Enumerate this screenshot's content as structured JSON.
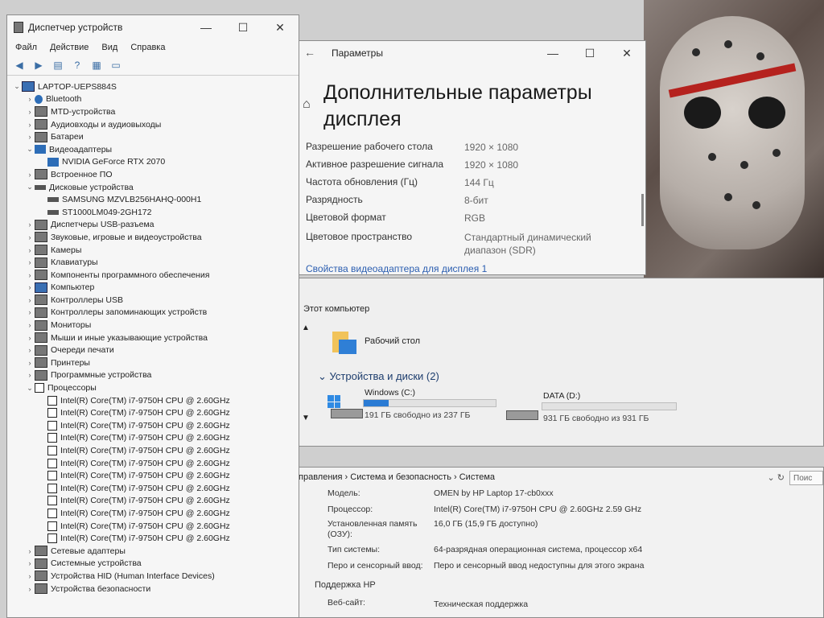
{
  "device_manager": {
    "title": "Диспетчер устройств",
    "menu": [
      "Файл",
      "Действие",
      "Вид",
      "Справка"
    ],
    "controls": {
      "minimize": "—",
      "maximize": "☐",
      "close": "✕"
    },
    "tree": [
      {
        "label": "LAPTOP-UEPS884S",
        "level": 0,
        "expanded": true,
        "icon": "computer-icon"
      },
      {
        "label": "Bluetooth",
        "level": 1,
        "icon": "bluetooth-icon"
      },
      {
        "label": "MTD-устройства",
        "level": 1,
        "icon": "device-icon"
      },
      {
        "label": "Аудиовходы и аудиовыходы",
        "level": 1,
        "icon": "audio-icon"
      },
      {
        "label": "Батареи",
        "level": 1,
        "icon": "battery-icon"
      },
      {
        "label": "Видеоадаптеры",
        "level": 1,
        "expanded": true,
        "icon": "display-adapter-icon"
      },
      {
        "label": "NVIDIA GeForce RTX 2070",
        "level": 2,
        "icon": "display-adapter-icon"
      },
      {
        "label": "Встроенное ПО",
        "level": 1,
        "icon": "firmware-icon"
      },
      {
        "label": "Дисковые устройства",
        "level": 1,
        "expanded": true,
        "icon": "disk-icon"
      },
      {
        "label": "SAMSUNG MZVLB256HAHQ-000H1",
        "level": 2,
        "icon": "disk-icon"
      },
      {
        "label": "ST1000LM049-2GH172",
        "level": 2,
        "icon": "disk-icon"
      },
      {
        "label": "Диспетчеры USB-разъема",
        "level": 1,
        "icon": "usb-icon"
      },
      {
        "label": "Звуковые, игровые и видеоустройства",
        "level": 1,
        "icon": "sound-icon"
      },
      {
        "label": "Камеры",
        "level": 1,
        "icon": "camera-icon"
      },
      {
        "label": "Клавиатуры",
        "level": 1,
        "icon": "keyboard-icon"
      },
      {
        "label": "Компоненты программного обеспечения",
        "level": 1,
        "icon": "software-icon"
      },
      {
        "label": "Компьютер",
        "level": 1,
        "icon": "computer-icon"
      },
      {
        "label": "Контроллеры USB",
        "level": 1,
        "icon": "usb-icon"
      },
      {
        "label": "Контроллеры запоминающих устройств",
        "level": 1,
        "icon": "storage-icon"
      },
      {
        "label": "Мониторы",
        "level": 1,
        "icon": "monitor-icon"
      },
      {
        "label": "Мыши и иные указывающие устройства",
        "level": 1,
        "icon": "mouse-icon"
      },
      {
        "label": "Очереди печати",
        "level": 1,
        "icon": "printer-icon"
      },
      {
        "label": "Принтеры",
        "level": 1,
        "icon": "printer-icon"
      },
      {
        "label": "Программные устройства",
        "level": 1,
        "icon": "software-icon"
      },
      {
        "label": "Процессоры",
        "level": 1,
        "expanded": true,
        "icon": "cpu-icon"
      },
      {
        "label": "Intel(R) Core(TM) i7-9750H CPU @ 2.60GHz",
        "level": 2,
        "icon": "cpu-icon"
      },
      {
        "label": "Intel(R) Core(TM) i7-9750H CPU @ 2.60GHz",
        "level": 2,
        "icon": "cpu-icon"
      },
      {
        "label": "Intel(R) Core(TM) i7-9750H CPU @ 2.60GHz",
        "level": 2,
        "icon": "cpu-icon"
      },
      {
        "label": "Intel(R) Core(TM) i7-9750H CPU @ 2.60GHz",
        "level": 2,
        "icon": "cpu-icon"
      },
      {
        "label": "Intel(R) Core(TM) i7-9750H CPU @ 2.60GHz",
        "level": 2,
        "icon": "cpu-icon"
      },
      {
        "label": "Intel(R) Core(TM) i7-9750H CPU @ 2.60GHz",
        "level": 2,
        "icon": "cpu-icon"
      },
      {
        "label": "Intel(R) Core(TM) i7-9750H CPU @ 2.60GHz",
        "level": 2,
        "icon": "cpu-icon"
      },
      {
        "label": "Intel(R) Core(TM) i7-9750H CPU @ 2.60GHz",
        "level": 2,
        "icon": "cpu-icon"
      },
      {
        "label": "Intel(R) Core(TM) i7-9750H CPU @ 2.60GHz",
        "level": 2,
        "icon": "cpu-icon"
      },
      {
        "label": "Intel(R) Core(TM) i7-9750H CPU @ 2.60GHz",
        "level": 2,
        "icon": "cpu-icon"
      },
      {
        "label": "Intel(R) Core(TM) i7-9750H CPU @ 2.60GHz",
        "level": 2,
        "icon": "cpu-icon"
      },
      {
        "label": "Intel(R) Core(TM) i7-9750H CPU @ 2.60GHz",
        "level": 2,
        "icon": "cpu-icon"
      },
      {
        "label": "Сетевые адаптеры",
        "level": 1,
        "icon": "network-icon"
      },
      {
        "label": "Системные устройства",
        "level": 1,
        "icon": "system-device-icon"
      },
      {
        "label": "Устройства HID (Human Interface Devices)",
        "level": 1,
        "icon": "hid-icon"
      },
      {
        "label": "Устройства безопасности",
        "level": 1,
        "icon": "security-device-icon"
      }
    ]
  },
  "settings": {
    "title": "Параметры",
    "heading_line1": "Дополнительные параметры",
    "heading_line2": "дисплея",
    "controls": {
      "minimize": "—",
      "maximize": "☐",
      "close": "✕"
    },
    "rows": [
      {
        "label": "Разрешение рабочего стола",
        "value": "1920 × 1080"
      },
      {
        "label": "Активное разрешение сигнала",
        "value": "1920 × 1080"
      },
      {
        "label": "Частота обновления (Гц)",
        "value": "144 Гц"
      },
      {
        "label": "Разрядность",
        "value": "8-бит"
      },
      {
        "label": "Цветовой формат",
        "value": "RGB"
      },
      {
        "label": "Цветовое пространство",
        "value": "Стандартный динамический диапазон (SDR)"
      }
    ],
    "adapter_link": "Свойства видеоадаптера для дисплея 1"
  },
  "this_pc": {
    "section": "Этот компьютер",
    "desktop": "Рабочий стол",
    "devices_group": "Устройства и диски (2)",
    "drives": [
      {
        "name": "Windows (C:)",
        "free": "191 ГБ свободно из 237 ГБ",
        "used_fraction": 0.19
      },
      {
        "name": "DATA (D:)",
        "free": "931 ГБ свободно из 931 ГБ",
        "used_fraction": 0.0
      }
    ]
  },
  "system": {
    "breadcrumb": "правления  ›  Система и безопасность  ›  Система",
    "search_placeholder": "Поис",
    "rows": [
      {
        "label": "Модель:",
        "value": "OMEN by HP Laptop 17-cb0xxx"
      },
      {
        "label": "Процессор:",
        "value": "Intel(R) Core(TM) i7-9750H CPU @ 2.60GHz   2.59 GHz"
      },
      {
        "label": "Установленная память (ОЗУ):",
        "value": "16,0 ГБ (15,9 ГБ доступно)"
      },
      {
        "label": "Тип системы:",
        "value": "64-разрядная операционная система, процессор x64"
      },
      {
        "label": "Перо и сенсорный ввод:",
        "value": "Перо и сенсорный ввод недоступны для этого экрана"
      }
    ],
    "support_header": "Поддержка HP",
    "website_label": "Веб-сайт:",
    "website_link": "Техническая поддержка"
  }
}
